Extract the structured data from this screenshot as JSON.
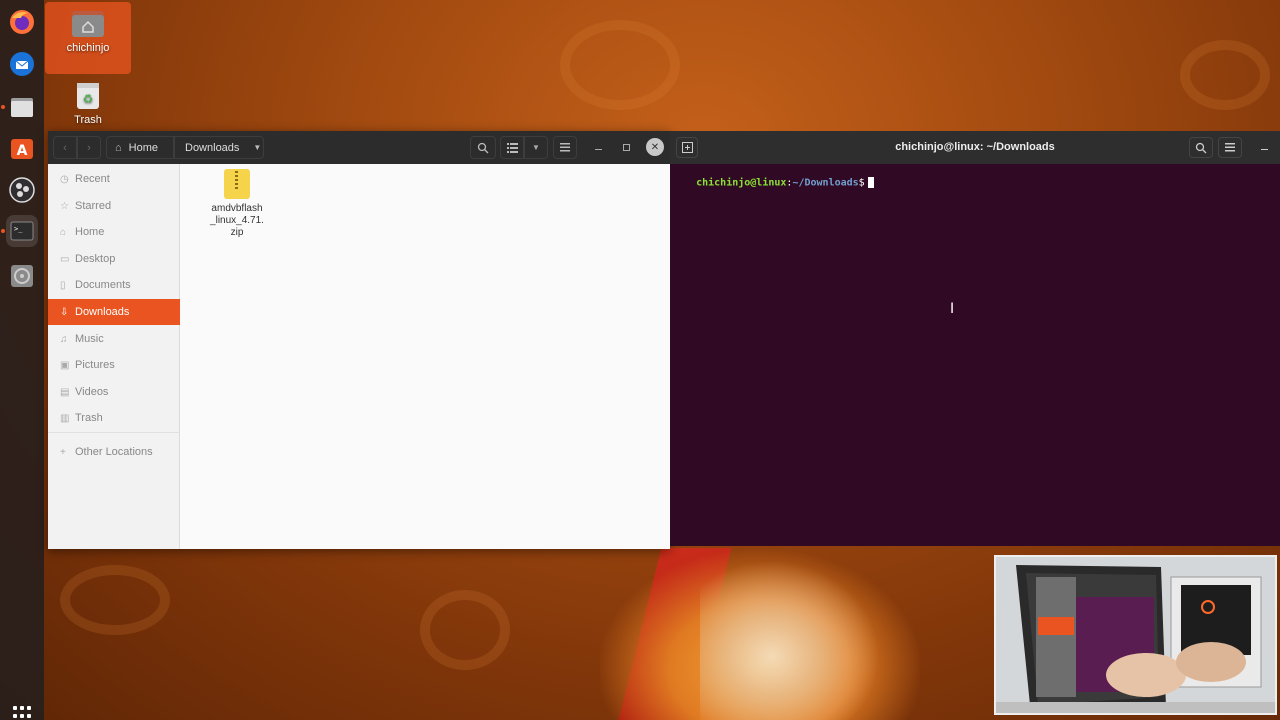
{
  "desktop": {
    "icons": [
      {
        "label": "chichinjo"
      },
      {
        "label": "Trash"
      }
    ]
  },
  "dock": {
    "items": [
      "firefox-icon",
      "thunderbird-icon",
      "files-icon",
      "software-icon",
      "obs-icon",
      "terminal-icon",
      "disc-icon",
      "show-apps-icon"
    ]
  },
  "files": {
    "breadcrumb": {
      "home": "Home",
      "current": "Downloads"
    },
    "sidebar": [
      {
        "label": "Recent",
        "icon": "clock-icon"
      },
      {
        "label": "Starred",
        "icon": "star-icon"
      },
      {
        "label": "Home",
        "icon": "home-icon"
      },
      {
        "label": "Desktop",
        "icon": "desktop-icon"
      },
      {
        "label": "Documents",
        "icon": "document-icon"
      },
      {
        "label": "Downloads",
        "icon": "download-icon",
        "active": true
      },
      {
        "label": "Music",
        "icon": "music-icon"
      },
      {
        "label": "Pictures",
        "icon": "picture-icon"
      },
      {
        "label": "Videos",
        "icon": "video-icon"
      },
      {
        "label": "Trash",
        "icon": "trash-icon"
      },
      {
        "label": "Other Locations",
        "icon": "plus-icon"
      }
    ],
    "file": {
      "line1": "amdvbflash",
      "line2": "_linux_4.71.",
      "line3": "zip"
    }
  },
  "terminal": {
    "title": "chichinjo@linux: ~/Downloads",
    "prompt_user": "chichinjo@linux",
    "prompt_sep": ":",
    "prompt_path": "~/Downloads",
    "prompt_symbol": "$"
  },
  "colors": {
    "accent": "#e95420",
    "terminal_bg": "#300a24",
    "prompt_user": "#8ae234",
    "prompt_path": "#729fcf"
  }
}
